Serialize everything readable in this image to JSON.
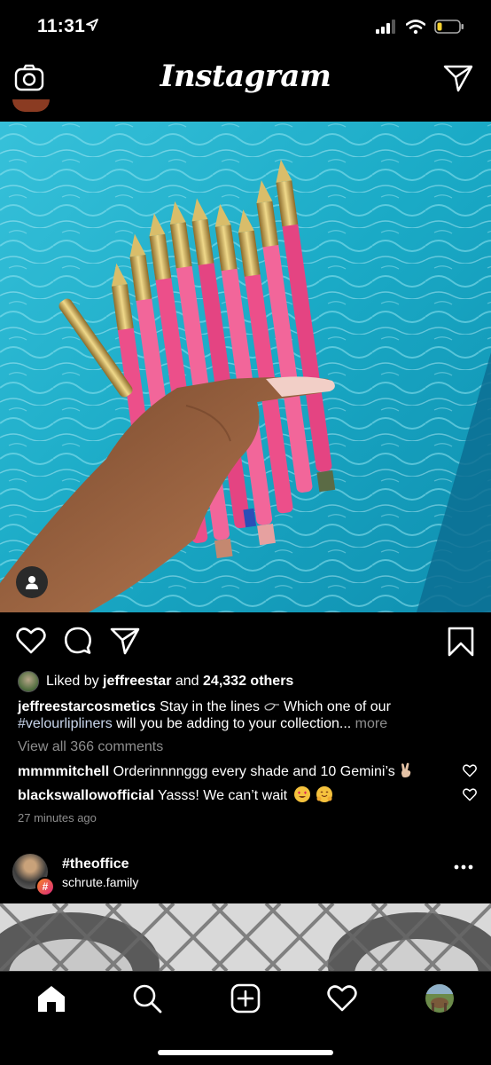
{
  "status_bar": {
    "time": "11:31",
    "icons": [
      "location-arrow-icon",
      "signal-icon",
      "wifi-icon",
      "battery-icon"
    ]
  },
  "header": {
    "title": "Instagram",
    "left_icon": "camera-icon",
    "right_icon": "direct-message-icon"
  },
  "post": {
    "action_icons": [
      "heart-icon",
      "comment-icon",
      "share-icon",
      "bookmark-icon"
    ],
    "liked_by_prefix": "Liked by",
    "liked_by_user": "jeffreestar",
    "liked_by_and": "and",
    "liked_by_others": "24,332 others",
    "caption_user": "jeffreestarcosmetics",
    "caption_text_1": "Stay in the lines",
    "caption_text_2": "Which one of our",
    "caption_hashtag": "#velourlipliners",
    "caption_text_3": "will you be adding to your collection...",
    "caption_more": "more",
    "view_comments": "View all 366 comments",
    "comments": [
      {
        "user": "mmmmitchell",
        "text": "Orderinnnnggg every shade and 10 Gemini’s"
      },
      {
        "user": "blackswallowofficial",
        "text": "Yasss! We can’t wait"
      }
    ],
    "timestamp": "27 minutes ago"
  },
  "next_post": {
    "title": "#theoffice",
    "subtitle": "schrute.family",
    "badge": "#"
  },
  "tabbar": {
    "items": [
      "home-icon",
      "search-icon",
      "new-post-icon",
      "activity-heart-icon",
      "profile-avatar"
    ]
  },
  "colors": {
    "background": "#000000",
    "text": "#ffffff",
    "muted": "#8e8e8e",
    "hashtag": "#c7d4ea",
    "water": "#18a6c2",
    "pencil_pink": "#ec4f8a"
  }
}
